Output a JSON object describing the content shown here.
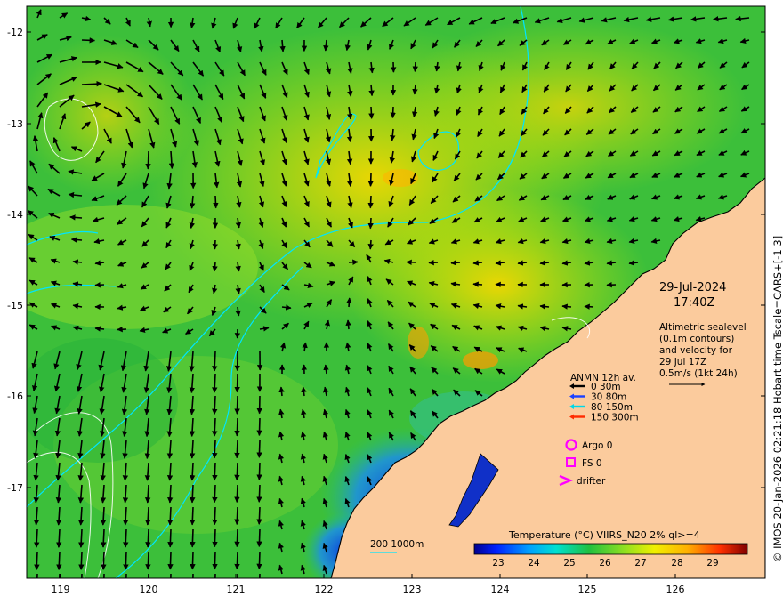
{
  "map": {
    "x_axis": {
      "ticks": [
        "119",
        "120",
        "121",
        "122",
        "123",
        "124",
        "125",
        "126"
      ]
    },
    "y_axis": {
      "ticks": [
        "-12",
        "-13",
        "-14",
        "-15",
        "-16",
        "-17"
      ]
    },
    "date_label": "29-Jul-2024",
    "time_label": "17:40Z",
    "altimetry_note": [
      "Altimetric sealevel",
      "(0.1m contours)",
      "and velocity for",
      "29 Jul 17Z",
      "0.5m/s (1kt 24h)"
    ],
    "anmn": {
      "title": "ANMN 12h av.",
      "items": [
        {
          "label": "0 30m",
          "color": "#000000"
        },
        {
          "label": "30 80m",
          "color": "#1a40ff"
        },
        {
          "label": "80 150m",
          "color": "#00d8e8"
        },
        {
          "label": "150 300m",
          "color": "#ff2a00"
        }
      ]
    },
    "markers": {
      "argo": "Argo 0",
      "fs": "FS 0",
      "drifter": "drifter",
      "marker_color": "#ff00ff"
    },
    "contour_legend": {
      "label": "200  1000m",
      "color": "#00e5ff"
    },
    "colorbar": {
      "title": "Temperature (°C) VIIRS_N20 2% ql>=4",
      "ticks": [
        "23",
        "24",
        "25",
        "26",
        "27",
        "28",
        "29"
      ]
    },
    "credit": "© IMOS 20-Jan-2026 02:21:18 Hobart time Tscale=CARS+[-1 3]",
    "colors": {
      "land": "#fbcb9d",
      "coast": "#000000",
      "contour": "#00e5ff",
      "sealevel_contour": "#ffffff",
      "arrow": "#000000"
    }
  }
}
